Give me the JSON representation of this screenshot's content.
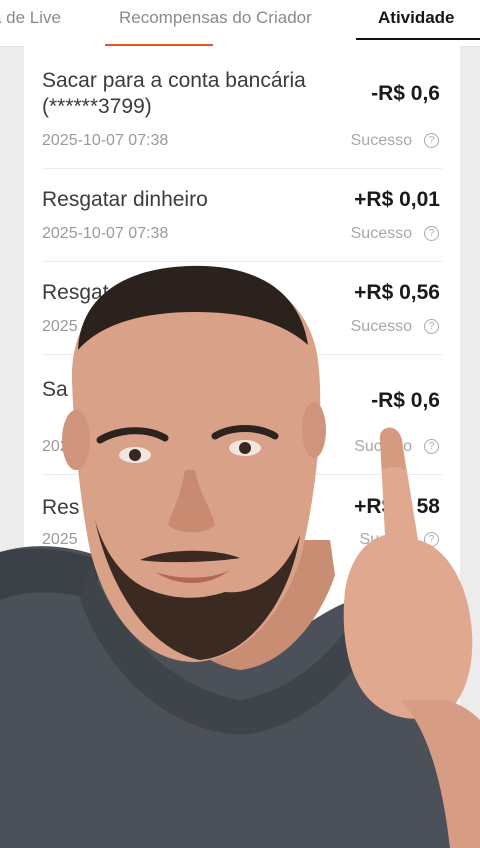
{
  "tabs": [
    {
      "label": "a de Live"
    },
    {
      "label": "Recompensas do Criador"
    },
    {
      "label": "Atividade"
    }
  ],
  "transactions": [
    {
      "title": "Sacar para a conta bancária (******3799)",
      "date": "2025-10-07 07:38",
      "amount": "-R$ 0,6",
      "status": "Sucesso"
    },
    {
      "title": "Resgatar dinheiro",
      "date": "2025-10-07 07:38",
      "amount": "+R$ 0,01",
      "status": "Sucesso"
    },
    {
      "title": "Resgata",
      "date": "2025",
      "amount": "+R$ 0,56",
      "status": "Sucesso"
    },
    {
      "title": "Sa                                a (**",
      "date": "202",
      "amount": "-R$ 0,6",
      "status": "Suce so"
    },
    {
      "title": "Res",
      "date": "2025",
      "amount": "+R$ 0 58",
      "status": "Sucess"
    }
  ],
  "icons": {
    "status_info": "question-circle-icon"
  },
  "colors": {
    "accent": "#e8531f",
    "shirt": "#4a4f58",
    "skin": "#d9a288",
    "hair": "#2a211c"
  }
}
